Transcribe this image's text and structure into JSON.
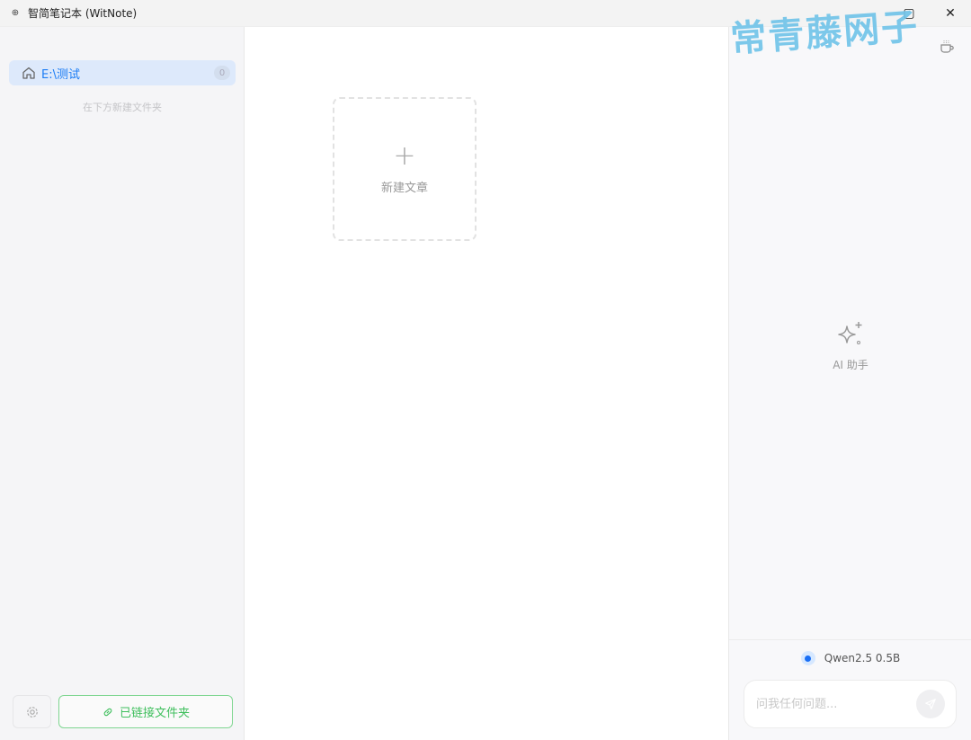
{
  "window": {
    "title": "智简笔记本 (WitNote)"
  },
  "sidebar": {
    "folders": [
      {
        "name": "E:\\测试",
        "count": "0"
      }
    ],
    "hint": "在下方新建文件夹",
    "linked_button": "已链接文件夹"
  },
  "main": {
    "new_article": "新建文章"
  },
  "ai_panel": {
    "title": "AI 助手",
    "model": "Qwen2.5 0.5B",
    "input_placeholder": "问我任何问题..."
  },
  "watermark": "常青藤网子"
}
